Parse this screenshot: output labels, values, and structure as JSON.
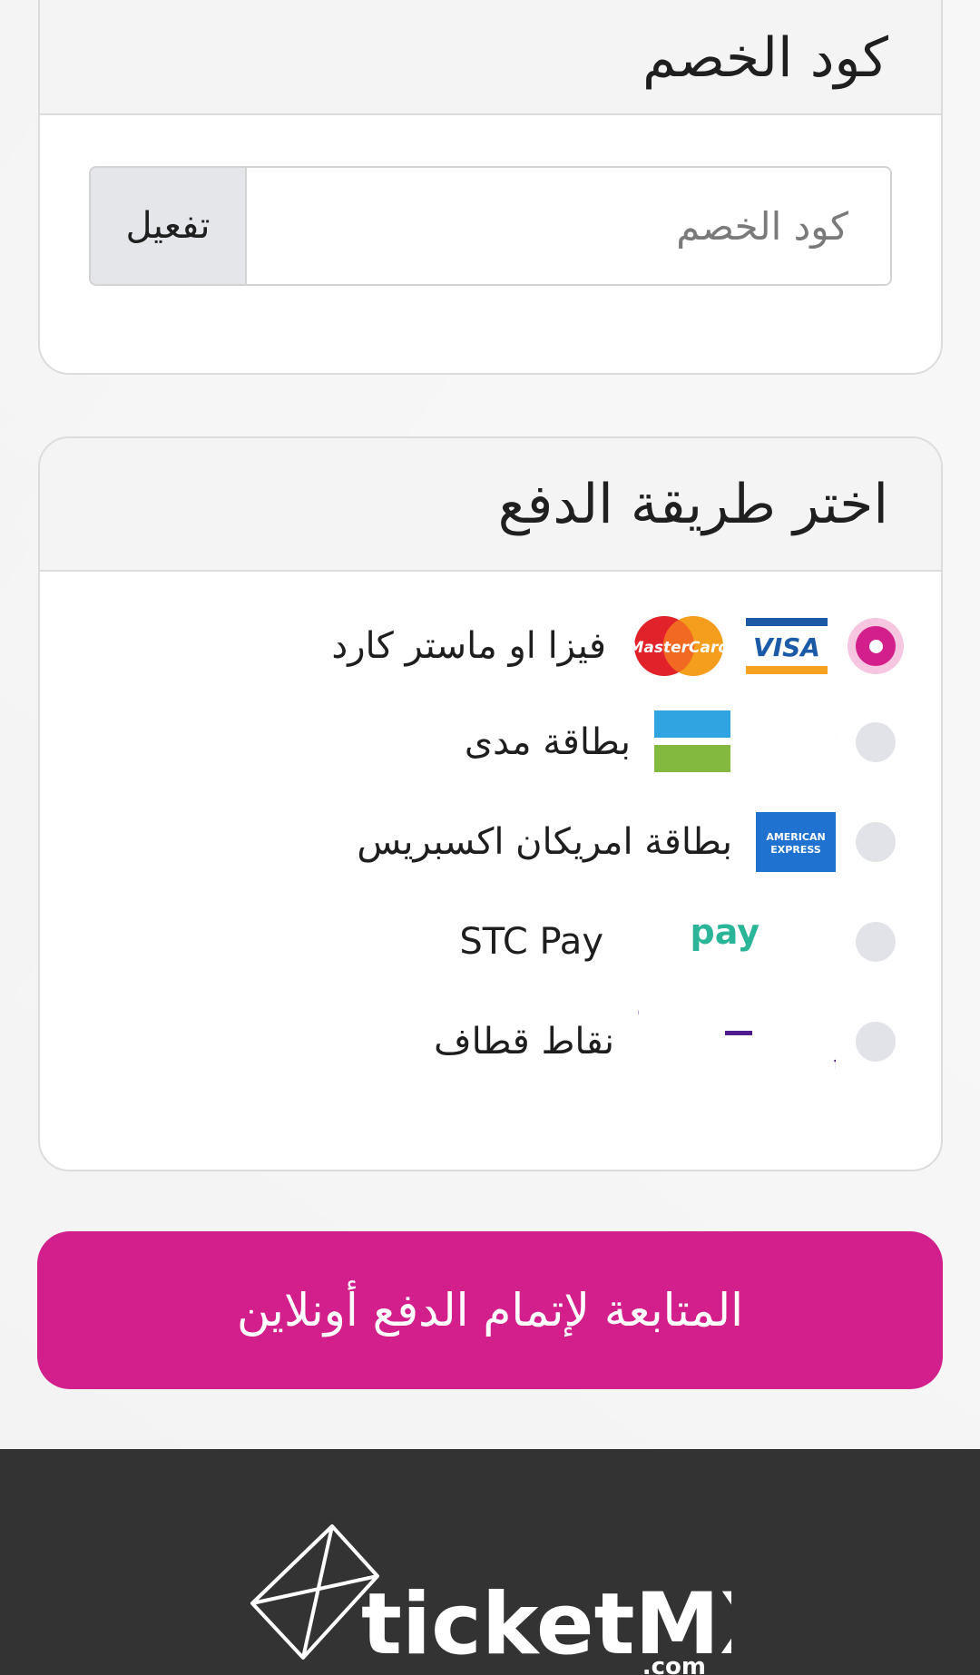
{
  "discount": {
    "title": "كود الخصم",
    "placeholder": "كود الخصم",
    "value": "",
    "activate_label": "تفعيل"
  },
  "payment": {
    "title": "اختر طريقة الدفع",
    "methods": [
      {
        "label": "فيزا او ماستر كارد",
        "selected": true,
        "icons": [
          "visa-logo",
          "mastercard-logo"
        ]
      },
      {
        "label": "بطاقة مدى",
        "selected": false,
        "icons": [
          "mada-logo"
        ]
      },
      {
        "label": "بطاقة امريكان اكسبريس",
        "selected": false,
        "icons": [
          "american-express-logo"
        ]
      },
      {
        "label": "STC Pay",
        "selected": false,
        "icons": [
          "stc-pay-logo"
        ]
      },
      {
        "label": "نقاط قطاف",
        "selected": false,
        "icons": [
          "qitaf-logo"
        ]
      }
    ]
  },
  "continue_label": "المتابعة لإتمام الدفع أونلاين",
  "footer": {
    "brand": "ticketMX",
    "brand_suffix": ".com"
  },
  "colors": {
    "accent": "#d31f8c",
    "footer_bg": "#333333",
    "radio_idle": "#e1e3e8"
  }
}
